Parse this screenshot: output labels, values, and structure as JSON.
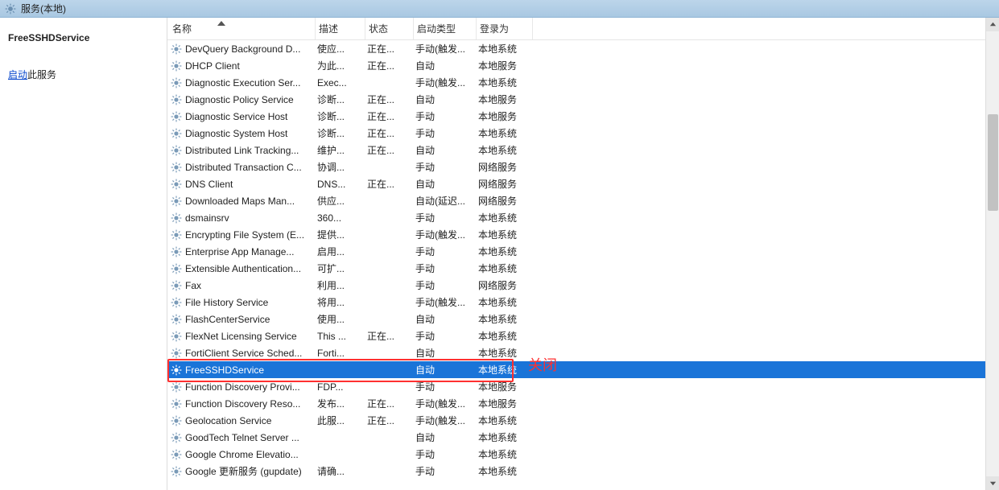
{
  "header": {
    "title": "服务(本地)"
  },
  "leftPanel": {
    "title": "FreeSSHDService",
    "startLink": "启动",
    "startSuffix": "此服务"
  },
  "columns": {
    "name": "名称",
    "desc": "描述",
    "status": "状态",
    "start": "启动类型",
    "logon": "登录为"
  },
  "annotation": {
    "closeLabel": "关闭"
  },
  "services": [
    {
      "name": "DevQuery Background D...",
      "desc": "使应...",
      "status": "正在...",
      "start": "手动(触发...",
      "logon": "本地系统"
    },
    {
      "name": "DHCP Client",
      "desc": "为此...",
      "status": "正在...",
      "start": "自动",
      "logon": "本地服务"
    },
    {
      "name": "Diagnostic Execution Ser...",
      "desc": "Exec...",
      "status": "",
      "start": "手动(触发...",
      "logon": "本地系统"
    },
    {
      "name": "Diagnostic Policy Service",
      "desc": "诊断...",
      "status": "正在...",
      "start": "自动",
      "logon": "本地服务"
    },
    {
      "name": "Diagnostic Service Host",
      "desc": "诊断...",
      "status": "正在...",
      "start": "手动",
      "logon": "本地服务"
    },
    {
      "name": "Diagnostic System Host",
      "desc": "诊断...",
      "status": "正在...",
      "start": "手动",
      "logon": "本地系统"
    },
    {
      "name": "Distributed Link Tracking...",
      "desc": "维护...",
      "status": "正在...",
      "start": "自动",
      "logon": "本地系统"
    },
    {
      "name": "Distributed Transaction C...",
      "desc": "协调...",
      "status": "",
      "start": "手动",
      "logon": "网络服务"
    },
    {
      "name": "DNS Client",
      "desc": "DNS...",
      "status": "正在...",
      "start": "自动",
      "logon": "网络服务"
    },
    {
      "name": "Downloaded Maps Man...",
      "desc": "供应...",
      "status": "",
      "start": "自动(延迟...",
      "logon": "网络服务"
    },
    {
      "name": "dsmainsrv",
      "desc": "360...",
      "status": "",
      "start": "手动",
      "logon": "本地系统"
    },
    {
      "name": "Encrypting File System (E...",
      "desc": "提供...",
      "status": "",
      "start": "手动(触发...",
      "logon": "本地系统"
    },
    {
      "name": "Enterprise App Manage...",
      "desc": "启用...",
      "status": "",
      "start": "手动",
      "logon": "本地系统"
    },
    {
      "name": "Extensible Authentication...",
      "desc": "可扩...",
      "status": "",
      "start": "手动",
      "logon": "本地系统"
    },
    {
      "name": "Fax",
      "desc": "利用...",
      "status": "",
      "start": "手动",
      "logon": "网络服务"
    },
    {
      "name": "File History Service",
      "desc": "将用...",
      "status": "",
      "start": "手动(触发...",
      "logon": "本地系统"
    },
    {
      "name": "FlashCenterService",
      "desc": "使用...",
      "status": "",
      "start": "自动",
      "logon": "本地系统"
    },
    {
      "name": "FlexNet Licensing Service",
      "desc": "This ...",
      "status": "正在...",
      "start": "手动",
      "logon": "本地系统"
    },
    {
      "name": "FortiClient Service Sched...",
      "desc": "Forti...",
      "status": "",
      "start": "自动",
      "logon": "本地系统"
    },
    {
      "name": "FreeSSHDService",
      "desc": "",
      "status": "",
      "start": "自动",
      "logon": "本地系统",
      "selected": true
    },
    {
      "name": "Function Discovery Provi...",
      "desc": "FDP...",
      "status": "",
      "start": "手动",
      "logon": "本地服务"
    },
    {
      "name": "Function Discovery Reso...",
      "desc": "发布...",
      "status": "正在...",
      "start": "手动(触发...",
      "logon": "本地服务"
    },
    {
      "name": "Geolocation Service",
      "desc": "此服...",
      "status": "正在...",
      "start": "手动(触发...",
      "logon": "本地系统"
    },
    {
      "name": "GoodTech Telnet Server ...",
      "desc": "",
      "status": "",
      "start": "自动",
      "logon": "本地系统"
    },
    {
      "name": "Google Chrome Elevatio...",
      "desc": "",
      "status": "",
      "start": "手动",
      "logon": "本地系统"
    },
    {
      "name": "Google 更新服务 (gupdate)",
      "desc": "请确...",
      "status": "",
      "start": "手动",
      "logon": "本地系统"
    }
  ]
}
